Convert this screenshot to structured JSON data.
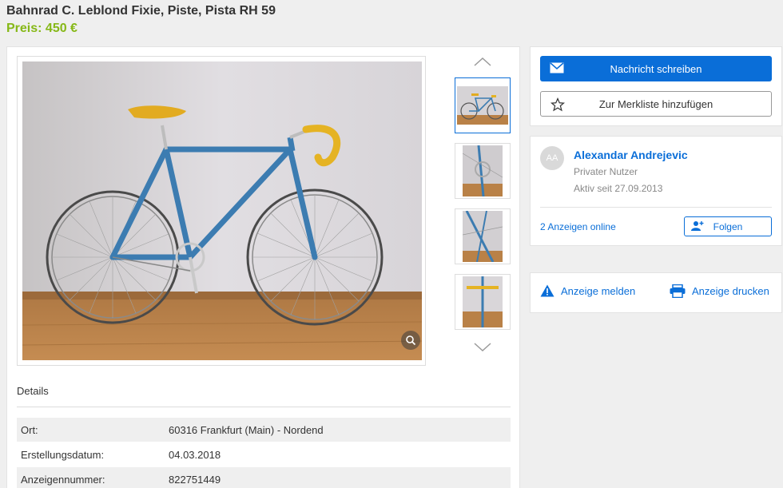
{
  "listing": {
    "title": "Bahnrad C. Leblond Fixie, Piste, Pista RH 59",
    "price": "Preis: 450 €"
  },
  "gallery": {
    "thumbnail_count": 4
  },
  "details": {
    "heading": "Details",
    "rows": [
      {
        "label": "Ort:",
        "value": "60316 Frankfurt (Main) - Nordend"
      },
      {
        "label": "Erstellungsdatum:",
        "value": "04.03.2018"
      },
      {
        "label": "Anzeigennummer:",
        "value": "822751449"
      }
    ]
  },
  "actions": {
    "message_label": "Nachricht schreiben",
    "watchlist_label": "Zur Merkliste hinzufügen"
  },
  "seller": {
    "initials": "AA",
    "name": "Alexandar Andrejevic",
    "type": "Privater Nutzer",
    "active_since": "Aktiv seit 27.09.2013",
    "ads_online": "2 Anzeigen online",
    "follow_label": "Folgen"
  },
  "tools": {
    "report_label": "Anzeige melden",
    "print_label": "Anzeige drucken"
  },
  "colors": {
    "accent": "#0a6ed8",
    "price": "#86b817",
    "background": "#efefef"
  }
}
